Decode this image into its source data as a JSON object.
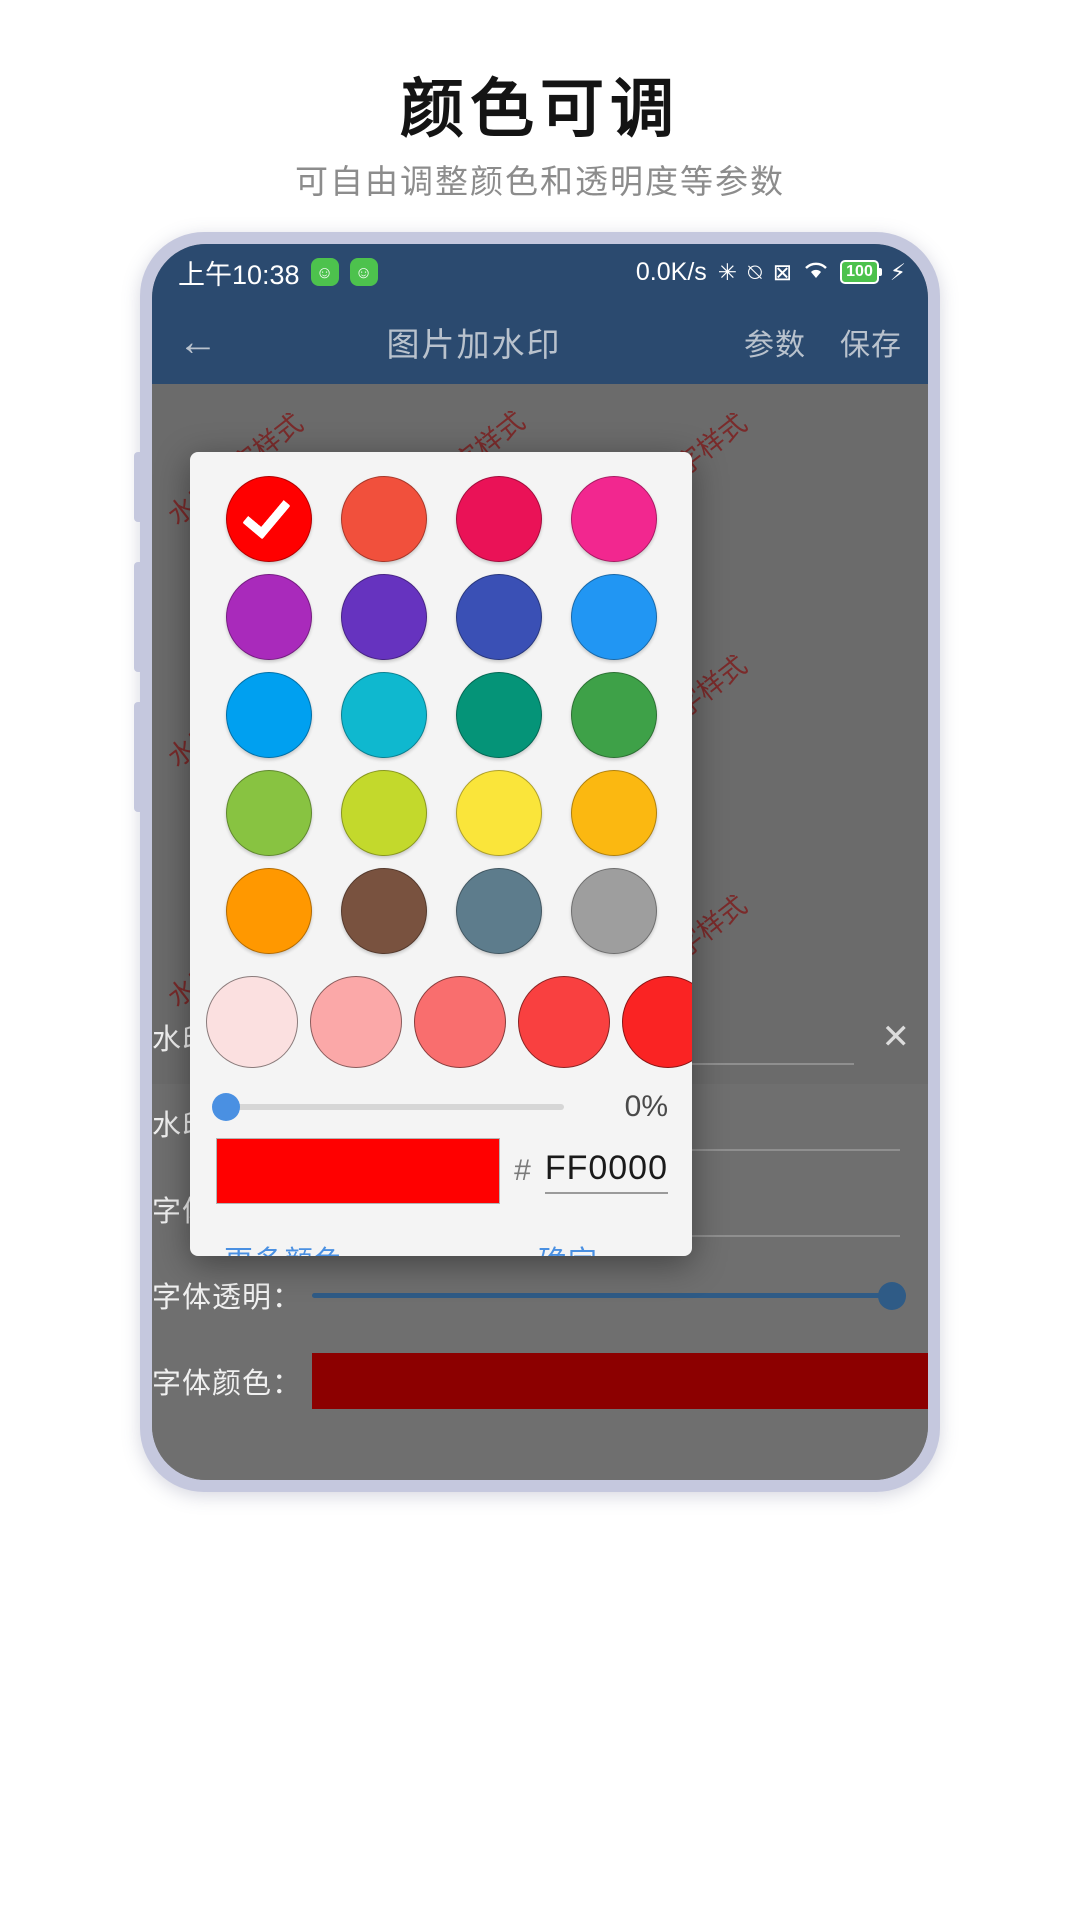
{
  "promo": {
    "title": "颜色可调",
    "subtitle": "可自由调整颜色和透明度等参数"
  },
  "statusbar": {
    "time": "上午10:38",
    "badge1": "☺",
    "badge2": "☺",
    "network_speed": "0.0K/s",
    "bluetooth_icon": "✳",
    "mute_icon": "⍉",
    "sim_icon": "⊠",
    "wifi_icon": "◥",
    "battery_level": "100",
    "charging_icon": "⚡"
  },
  "toolbar": {
    "back_icon": "←",
    "title": "图片加水印",
    "params_label": "参数",
    "save_label": "保存"
  },
  "canvas": {
    "watermark_text": "水印文字样式"
  },
  "form": {
    "rows": [
      {
        "label": "水印内",
        "value": "",
        "type": "text"
      },
      {
        "label": "水印角",
        "value": "",
        "type": "text"
      },
      {
        "label": "字体大",
        "value": "",
        "type": "text"
      },
      {
        "label": "字体透明：",
        "value": "",
        "type": "slider"
      },
      {
        "label": "字体颜色：",
        "value": "",
        "type": "color"
      }
    ],
    "close_icon": "✕",
    "font_color_value": "#8C0000"
  },
  "navbar": {
    "back_icon": "‹",
    "home_icon": "home-square",
    "menu_icon": "☰"
  },
  "dialog": {
    "palette": [
      {
        "hex": "#FF0000",
        "selected": true
      },
      {
        "hex": "#F1503C",
        "selected": false
      },
      {
        "hex": "#EA1257",
        "selected": false
      },
      {
        "hex": "#F2278F",
        "selected": false
      },
      {
        "hex": "#A92ABB",
        "selected": false
      },
      {
        "hex": "#6633BF",
        "selected": false
      },
      {
        "hex": "#3A50B5",
        "selected": false
      },
      {
        "hex": "#2196F3",
        "selected": false
      },
      {
        "hex": "#00A0F0",
        "selected": false
      },
      {
        "hex": "#0FB8CF",
        "selected": false
      },
      {
        "hex": "#059478",
        "selected": false
      },
      {
        "hex": "#3EA148",
        "selected": false
      },
      {
        "hex": "#88C341",
        "selected": false
      },
      {
        "hex": "#C3D92C",
        "selected": false
      },
      {
        "hex": "#FAE53A",
        "selected": false
      },
      {
        "hex": "#FBB811",
        "selected": false
      },
      {
        "hex": "#FF9800",
        "selected": false
      },
      {
        "hex": "#79523F",
        "selected": false
      },
      {
        "hex": "#5D7C8C",
        "selected": false
      },
      {
        "hex": "#9E9E9E",
        "selected": false
      }
    ],
    "check_icon": "checkmark-icon",
    "shades": [
      {
        "hex": "#FBE0E0"
      },
      {
        "hex": "#FBA8A8"
      },
      {
        "hex": "#F96E6E"
      },
      {
        "hex": "#F94040"
      },
      {
        "hex": "#FA2323"
      }
    ],
    "alpha_value": "0%",
    "alpha_percent": 0,
    "preview_hex": "#FF0000",
    "hash_symbol": "#",
    "hex_value": "FF0000",
    "more_colors_label": "更多颜色",
    "confirm_label": "确定"
  }
}
